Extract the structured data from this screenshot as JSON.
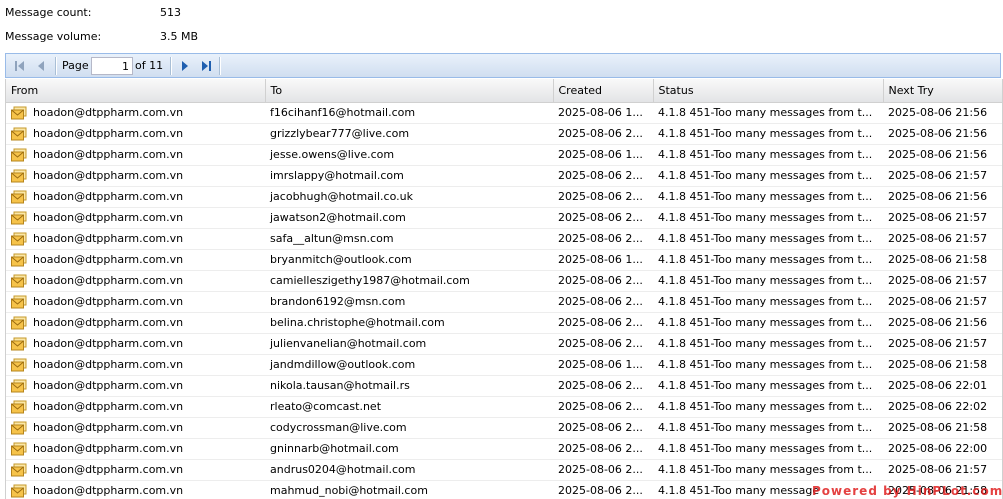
{
  "stats": {
    "count_label": "Message count:",
    "count_value": "513",
    "volume_label": "Message volume:",
    "volume_value": "3.5 MB"
  },
  "pager": {
    "page_label": "Page",
    "page_value": "1",
    "of_label": "of 11",
    "icons": [
      "first-page-icon",
      "prev-page-icon",
      "next-page-icon",
      "last-page-icon"
    ]
  },
  "grid": {
    "columns": [
      "From",
      "To",
      "Created",
      "Status",
      "Next Try"
    ],
    "row_icon": "envelope-icon",
    "rows": [
      {
        "from": "hoadon@dtppharm.com.vn",
        "to": "f16cihanf16@hotmail.com",
        "created": "2025-08-06 1...",
        "status": "4.1.8 451-Too many messages from t...",
        "next": "2025-08-06 21:56"
      },
      {
        "from": "hoadon@dtppharm.com.vn",
        "to": "grizzlybear777@live.com",
        "created": "2025-08-06 2...",
        "status": "4.1.8 451-Too many messages from t...",
        "next": "2025-08-06 21:56"
      },
      {
        "from": "hoadon@dtppharm.com.vn",
        "to": "jesse.owens@live.com",
        "created": "2025-08-06 1...",
        "status": "4.1.8 451-Too many messages from t...",
        "next": "2025-08-06 21:56"
      },
      {
        "from": "hoadon@dtppharm.com.vn",
        "to": "imrslappy@hotmail.com",
        "created": "2025-08-06 2...",
        "status": "4.1.8 451-Too many messages from t...",
        "next": "2025-08-06 21:57"
      },
      {
        "from": "hoadon@dtppharm.com.vn",
        "to": "jacobhugh@hotmail.co.uk",
        "created": "2025-08-06 2...",
        "status": "4.1.8 451-Too many messages from t...",
        "next": "2025-08-06 21:56"
      },
      {
        "from": "hoadon@dtppharm.com.vn",
        "to": "jawatson2@hotmail.com",
        "created": "2025-08-06 2...",
        "status": "4.1.8 451-Too many messages from t...",
        "next": "2025-08-06 21:57"
      },
      {
        "from": "hoadon@dtppharm.com.vn",
        "to": "safa__altun@msn.com",
        "created": "2025-08-06 2...",
        "status": "4.1.8 451-Too many messages from t...",
        "next": "2025-08-06 21:57"
      },
      {
        "from": "hoadon@dtppharm.com.vn",
        "to": "bryanmitch@outlook.com",
        "created": "2025-08-06 1...",
        "status": "4.1.8 451-Too many messages from t...",
        "next": "2025-08-06 21:58"
      },
      {
        "from": "hoadon@dtppharm.com.vn",
        "to": "camielleszigethy1987@hotmail.com",
        "created": "2025-08-06 2...",
        "status": "4.1.8 451-Too many messages from t...",
        "next": "2025-08-06 21:57"
      },
      {
        "from": "hoadon@dtppharm.com.vn",
        "to": "brandon6192@msn.com",
        "created": "2025-08-06 2...",
        "status": "4.1.8 451-Too many messages from t...",
        "next": "2025-08-06 21:57"
      },
      {
        "from": "hoadon@dtppharm.com.vn",
        "to": "belina.christophe@hotmail.com",
        "created": "2025-08-06 2...",
        "status": "4.1.8 451-Too many messages from t...",
        "next": "2025-08-06 21:56"
      },
      {
        "from": "hoadon@dtppharm.com.vn",
        "to": "julienvanelian@hotmail.com",
        "created": "2025-08-06 2...",
        "status": "4.1.8 451-Too many messages from t...",
        "next": "2025-08-06 21:57"
      },
      {
        "from": "hoadon@dtppharm.com.vn",
        "to": "jandmdillow@outlook.com",
        "created": "2025-08-06 1...",
        "status": "4.1.8 451-Too many messages from t...",
        "next": "2025-08-06 21:58"
      },
      {
        "from": "hoadon@dtppharm.com.vn",
        "to": "nikola.tausan@hotmail.rs",
        "created": "2025-08-06 2...",
        "status": "4.1.8 451-Too many messages from t...",
        "next": "2025-08-06 22:01"
      },
      {
        "from": "hoadon@dtppharm.com.vn",
        "to": "rleato@comcast.net",
        "created": "2025-08-06 2...",
        "status": "4.1.8 451-Too many messages from t...",
        "next": "2025-08-06 22:02"
      },
      {
        "from": "hoadon@dtppharm.com.vn",
        "to": "codycrossman@live.com",
        "created": "2025-08-06 2...",
        "status": "4.1.8 451-Too many messages from t...",
        "next": "2025-08-06 21:58"
      },
      {
        "from": "hoadon@dtppharm.com.vn",
        "to": "gninnarb@hotmail.com",
        "created": "2025-08-06 2...",
        "status": "4.1.8 451-Too many messages from t...",
        "next": "2025-08-06 22:00"
      },
      {
        "from": "hoadon@dtppharm.com.vn",
        "to": "andrus0204@hotmail.com",
        "created": "2025-08-06 2...",
        "status": "4.1.8 451-Too many messages from t...",
        "next": "2025-08-06 21:57"
      },
      {
        "from": "hoadon@dtppharm.com.vn",
        "to": "mahmud_nobi@hotmail.com",
        "created": "2025-08-06 2...",
        "status": "4.1.8 451-Too many message",
        "next": "2025-08-06 21:58"
      }
    ]
  },
  "footer": {
    "powered_text": "Powered by HinPLot.com"
  }
}
